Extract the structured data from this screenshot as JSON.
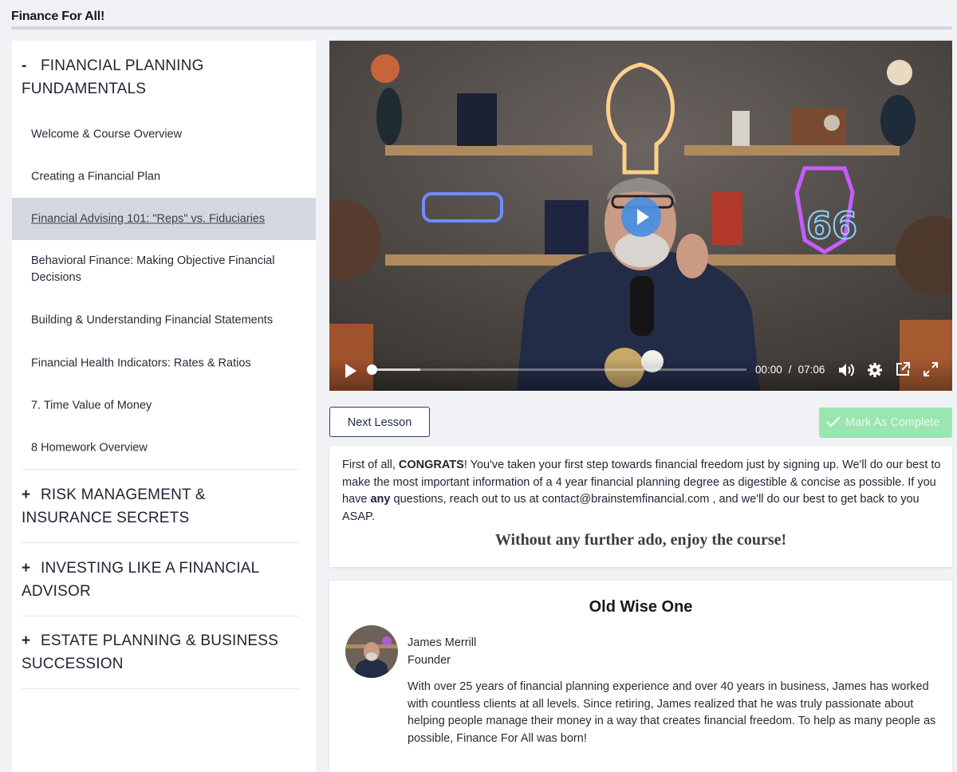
{
  "app": {
    "title": "Finance For All!"
  },
  "sidebar": {
    "sections": [
      {
        "sign": "-",
        "title": "FINANCIAL PLANNING FUNDAMENTALS",
        "expanded": true,
        "lessons": [
          {
            "label": "Welcome & Course Overview"
          },
          {
            "label": "Creating a Financial Plan"
          },
          {
            "label": "Financial Advising 101: \"Reps\" vs. Fiduciaries",
            "active": true
          },
          {
            "label": "Behavioral Finance: Making Objective Financial Decisions"
          },
          {
            "label": "Building & Understanding Financial Statements"
          },
          {
            "label": "Financial Health Indicators: Rates & Ratios"
          },
          {
            "label": "7. Time Value of Money"
          },
          {
            "label": "8 Homework Overview"
          }
        ]
      },
      {
        "sign": "+",
        "title": "RISK MANAGEMENT & INSURANCE SECRETS",
        "expanded": false
      },
      {
        "sign": "+",
        "title": "INVESTING LIKE A FINANCIAL ADVISOR",
        "expanded": false
      },
      {
        "sign": "+",
        "title": "ESTATE PLANNING & BUSINESS SUCCESSION",
        "expanded": false
      }
    ]
  },
  "video": {
    "current_time": "00:00",
    "separator": "/",
    "duration": "07:06",
    "progress": 0.0,
    "buffered": 0.13,
    "icons": [
      "play-icon",
      "volume-icon",
      "settings-gear-icon",
      "popout-icon",
      "fullscreen-icon"
    ]
  },
  "actions": {
    "next_label": "Next Lesson",
    "complete_label": "Mark As Complete"
  },
  "intro": {
    "p_start": "First of all, ",
    "p_bold1": "CONGRATS",
    "p_mid": "! You've taken your first step towards financial freedom just by signing up. We'll do our best to make the most important information of a 4 year financial planning degree as digestible & concise as possible. If you have ",
    "p_bold2": "any",
    "p_end": " questions, reach out to us at contact@brainstemfinancial.com , and we'll do our best to get back to you ASAP.",
    "tagline": "Without any further ado, enjoy the course!"
  },
  "about": {
    "title": "Old Wise One",
    "name": "James Merrill",
    "role": "Founder",
    "bio": "With over 25 years of financial planning experience and over 40 years in business, James has worked with countless clients at all levels. Since retiring, James realized that he was truly passionate about helping people manage their money in a way that creates financial freedom. To help as many people as possible, Finance For All was born!"
  },
  "colors": {
    "accent_blue": "#4a90e2",
    "complete_green": "#9ae6b0",
    "active_row": "#d4d7df",
    "page_bg": "#f1f2f6"
  }
}
